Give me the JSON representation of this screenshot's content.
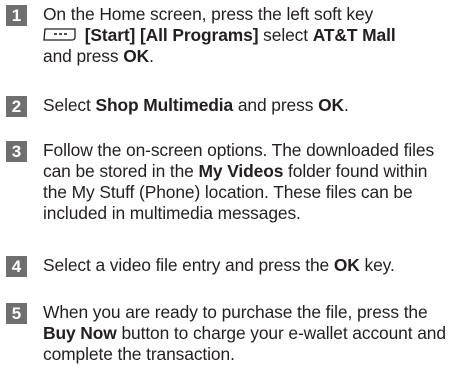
{
  "steps": [
    {
      "number": "1",
      "line1": "On the Home screen, press the left soft key",
      "softkey_icon": "left-soft-key-icon",
      "start_label": "[Start]",
      "all_programs_label": "[All Programs]",
      "select_text": "select",
      "mall_label": "AT&T Mall",
      "press_text": "and press",
      "ok_label": "OK",
      "end": "."
    },
    {
      "number": "2",
      "select_text": "Select",
      "item_label": "Shop Multimedia",
      "press_text": "and press",
      "ok_label": "OK",
      "end": "."
    },
    {
      "number": "3",
      "text_before": "Follow the on-screen options. The downloaded files can be stored in the",
      "folder_label": "My Videos",
      "text_after": "folder found within the My Stuff (Phone) location. These files can be included in multimedia messages."
    },
    {
      "number": "4",
      "text_before": "Select a video file entry and press the",
      "ok_label": "OK",
      "text_after": "key."
    },
    {
      "number": "5",
      "text_before": "When you are ready to purchase the file, press the",
      "button_label": "Buy Now",
      "text_after": "button to charge your e-wallet account and complete the transaction."
    }
  ],
  "colors": {
    "badge_background": "#6f6f6f",
    "badge_text": "#ffffff",
    "body_text": "#231f20"
  }
}
